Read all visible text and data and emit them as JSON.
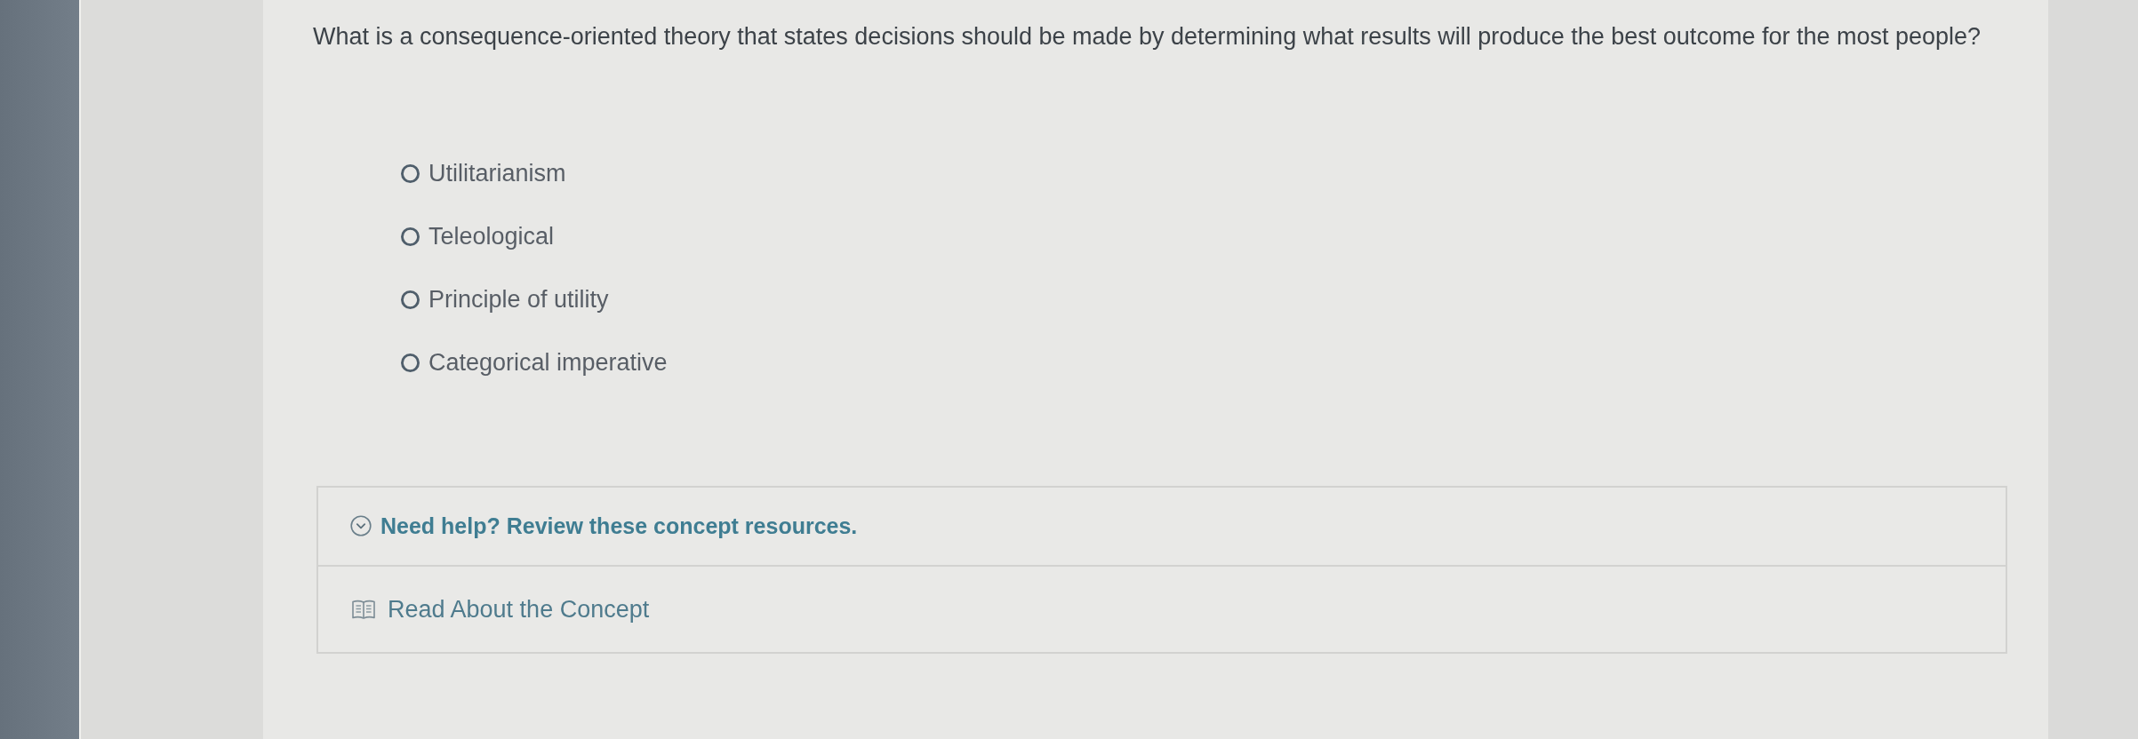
{
  "question": {
    "text": "What is a consequence-oriented theory that states decisions should be made by determining what results will produce the best outcome for the most people?"
  },
  "options": [
    {
      "label": "Utilitarianism",
      "selected": false
    },
    {
      "label": "Teleological",
      "selected": false
    },
    {
      "label": "Principle of utility",
      "selected": false
    },
    {
      "label": "Categorical imperative",
      "selected": false
    }
  ],
  "help": {
    "title": "Need help? Review these concept resources.",
    "expanded": true,
    "resources": [
      {
        "label": "Read About the Concept",
        "kind": "reading"
      }
    ]
  }
}
